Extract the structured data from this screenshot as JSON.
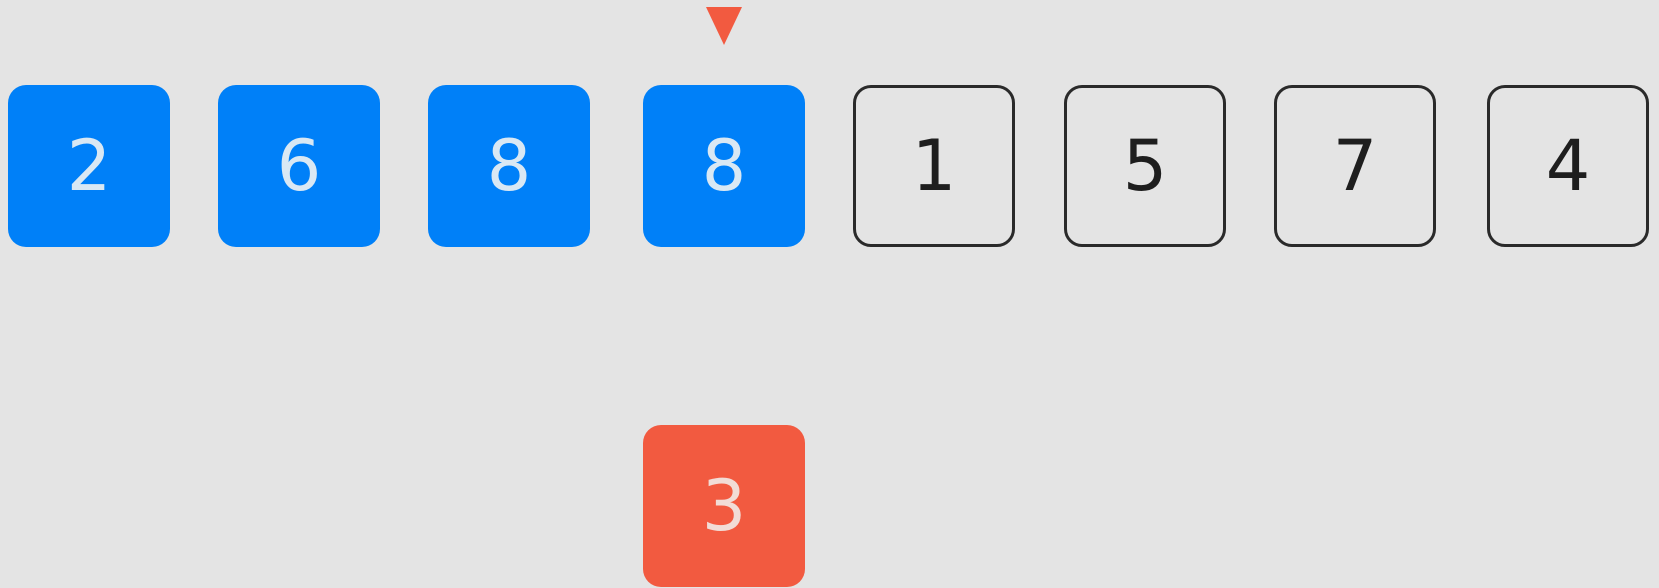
{
  "colors": {
    "background": "#e4e4e4",
    "sorted_fill": "#0080f8",
    "sorted_text": "#d9e8f4",
    "unsorted_border": "#2a2a2a",
    "unsorted_text": "#1e1e1e",
    "held_fill": "#f25a40",
    "held_text": "#f2dcd6",
    "marker": "#f25a40"
  },
  "array": {
    "cells": [
      {
        "value": "2",
        "state": "sorted"
      },
      {
        "value": "6",
        "state": "sorted"
      },
      {
        "value": "8",
        "state": "sorted"
      },
      {
        "value": "8",
        "state": "sorted"
      },
      {
        "value": "1",
        "state": "unsorted"
      },
      {
        "value": "5",
        "state": "unsorted"
      },
      {
        "value": "7",
        "state": "unsorted"
      },
      {
        "value": "4",
        "state": "unsorted"
      }
    ],
    "marker_index": 3,
    "marker_icon": "down-triangle-icon"
  },
  "held": {
    "value": "3"
  }
}
